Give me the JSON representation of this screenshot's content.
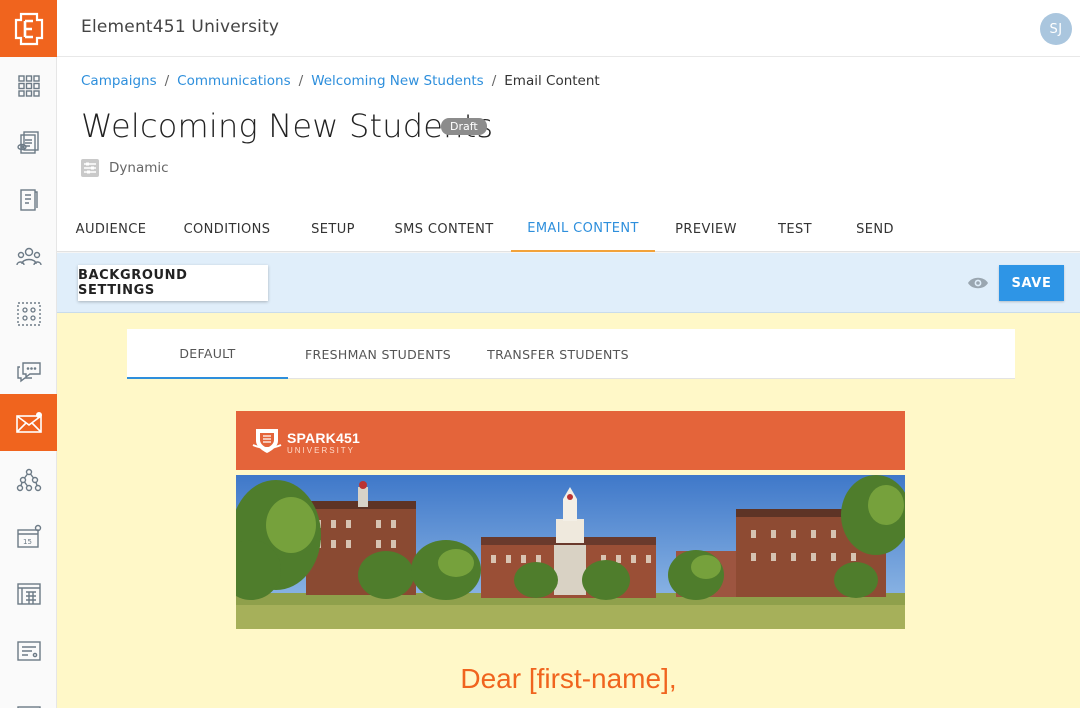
{
  "app": {
    "title": "Element451 University",
    "avatar_initials": "SJ",
    "logo_letter": "E"
  },
  "sidebar": {
    "items": [
      {
        "icon": "grid-icon"
      },
      {
        "icon": "view-list-icon"
      },
      {
        "icon": "form-icon"
      },
      {
        "icon": "people-icon"
      },
      {
        "icon": "segments-icon"
      },
      {
        "icon": "chat-icon"
      },
      {
        "icon": "mail-icon",
        "active": true
      },
      {
        "icon": "hierarchy-icon"
      },
      {
        "icon": "calendar-icon"
      },
      {
        "icon": "grid-layout-icon"
      },
      {
        "icon": "form-fields-icon"
      },
      {
        "icon": "misc-icon"
      }
    ],
    "accent": "#f0641e"
  },
  "breadcrumb": {
    "items": [
      "Campaigns",
      "Communications",
      "Welcoming New Students",
      "Email Content"
    ],
    "separator": "/"
  },
  "page": {
    "title": "Welcoming New Students",
    "status": "Draft",
    "type": "Dynamic"
  },
  "tabs": [
    "AUDIENCE",
    "CONDITIONS",
    "SETUP",
    "SMS CONTENT",
    "EMAIL CONTENT",
    "PREVIEW",
    "TEST",
    "SEND"
  ],
  "active_tab": "EMAIL CONTENT",
  "toolbar": {
    "background_settings": "BACKGROUND SETTINGS",
    "save": "SAVE"
  },
  "segment_tabs": [
    "DEFAULT",
    "FRESHMAN STUDENTS",
    "TRANSFER STUDENTS"
  ],
  "active_segment": "DEFAULT",
  "email": {
    "university_name": "SPARK451",
    "university_sub": "UNIVERSITY",
    "greeting": "Dear [first-name],",
    "header_color": "#e4643a"
  },
  "colors": {
    "link": "#2e8fdc",
    "save": "#2e95e6",
    "canvas": "#fff8c8",
    "toolbar": "#e0eefa"
  }
}
